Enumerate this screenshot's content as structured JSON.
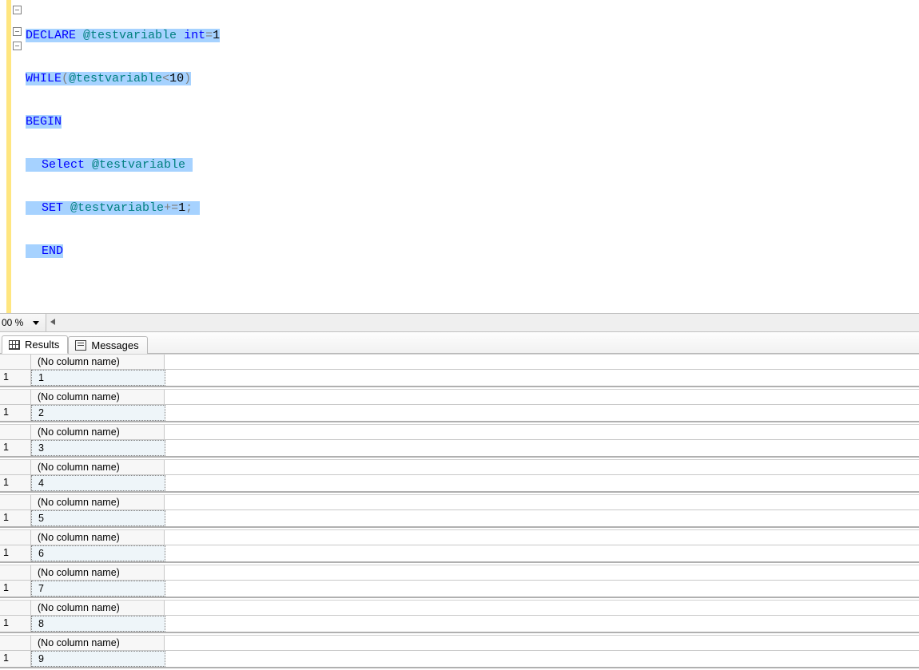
{
  "code": {
    "l1_declare": "DECLARE",
    "l1_var": "@testvariable",
    "l1_type": "int",
    "l1_eq": "=",
    "l1_val": "1",
    "l2_while": "WHILE",
    "l2_lp": "(",
    "l2_var": "@testvariable",
    "l2_lt": "<",
    "l2_val": "10",
    "l2_rp": ")",
    "l3_begin": "BEGIN",
    "l4_select": "Select",
    "l4_var": "@testvariable",
    "l5_set": "SET",
    "l5_var": "@testvariable",
    "l5_op": "+=",
    "l5_val": "1",
    "l5_sc": ";",
    "l6_end": "END"
  },
  "zoom": {
    "value": "00 %"
  },
  "tabs": {
    "results": "Results",
    "messages": "Messages"
  },
  "results": [
    {
      "header": "(No column name)",
      "rownum": "1",
      "value": "1"
    },
    {
      "header": "(No column name)",
      "rownum": "1",
      "value": "2"
    },
    {
      "header": "(No column name)",
      "rownum": "1",
      "value": "3"
    },
    {
      "header": "(No column name)",
      "rownum": "1",
      "value": "4"
    },
    {
      "header": "(No column name)",
      "rownum": "1",
      "value": "5"
    },
    {
      "header": "(No column name)",
      "rownum": "1",
      "value": "6"
    },
    {
      "header": "(No column name)",
      "rownum": "1",
      "value": "7"
    },
    {
      "header": "(No column name)",
      "rownum": "1",
      "value": "8"
    },
    {
      "header": "(No column name)",
      "rownum": "1",
      "value": "9"
    }
  ]
}
